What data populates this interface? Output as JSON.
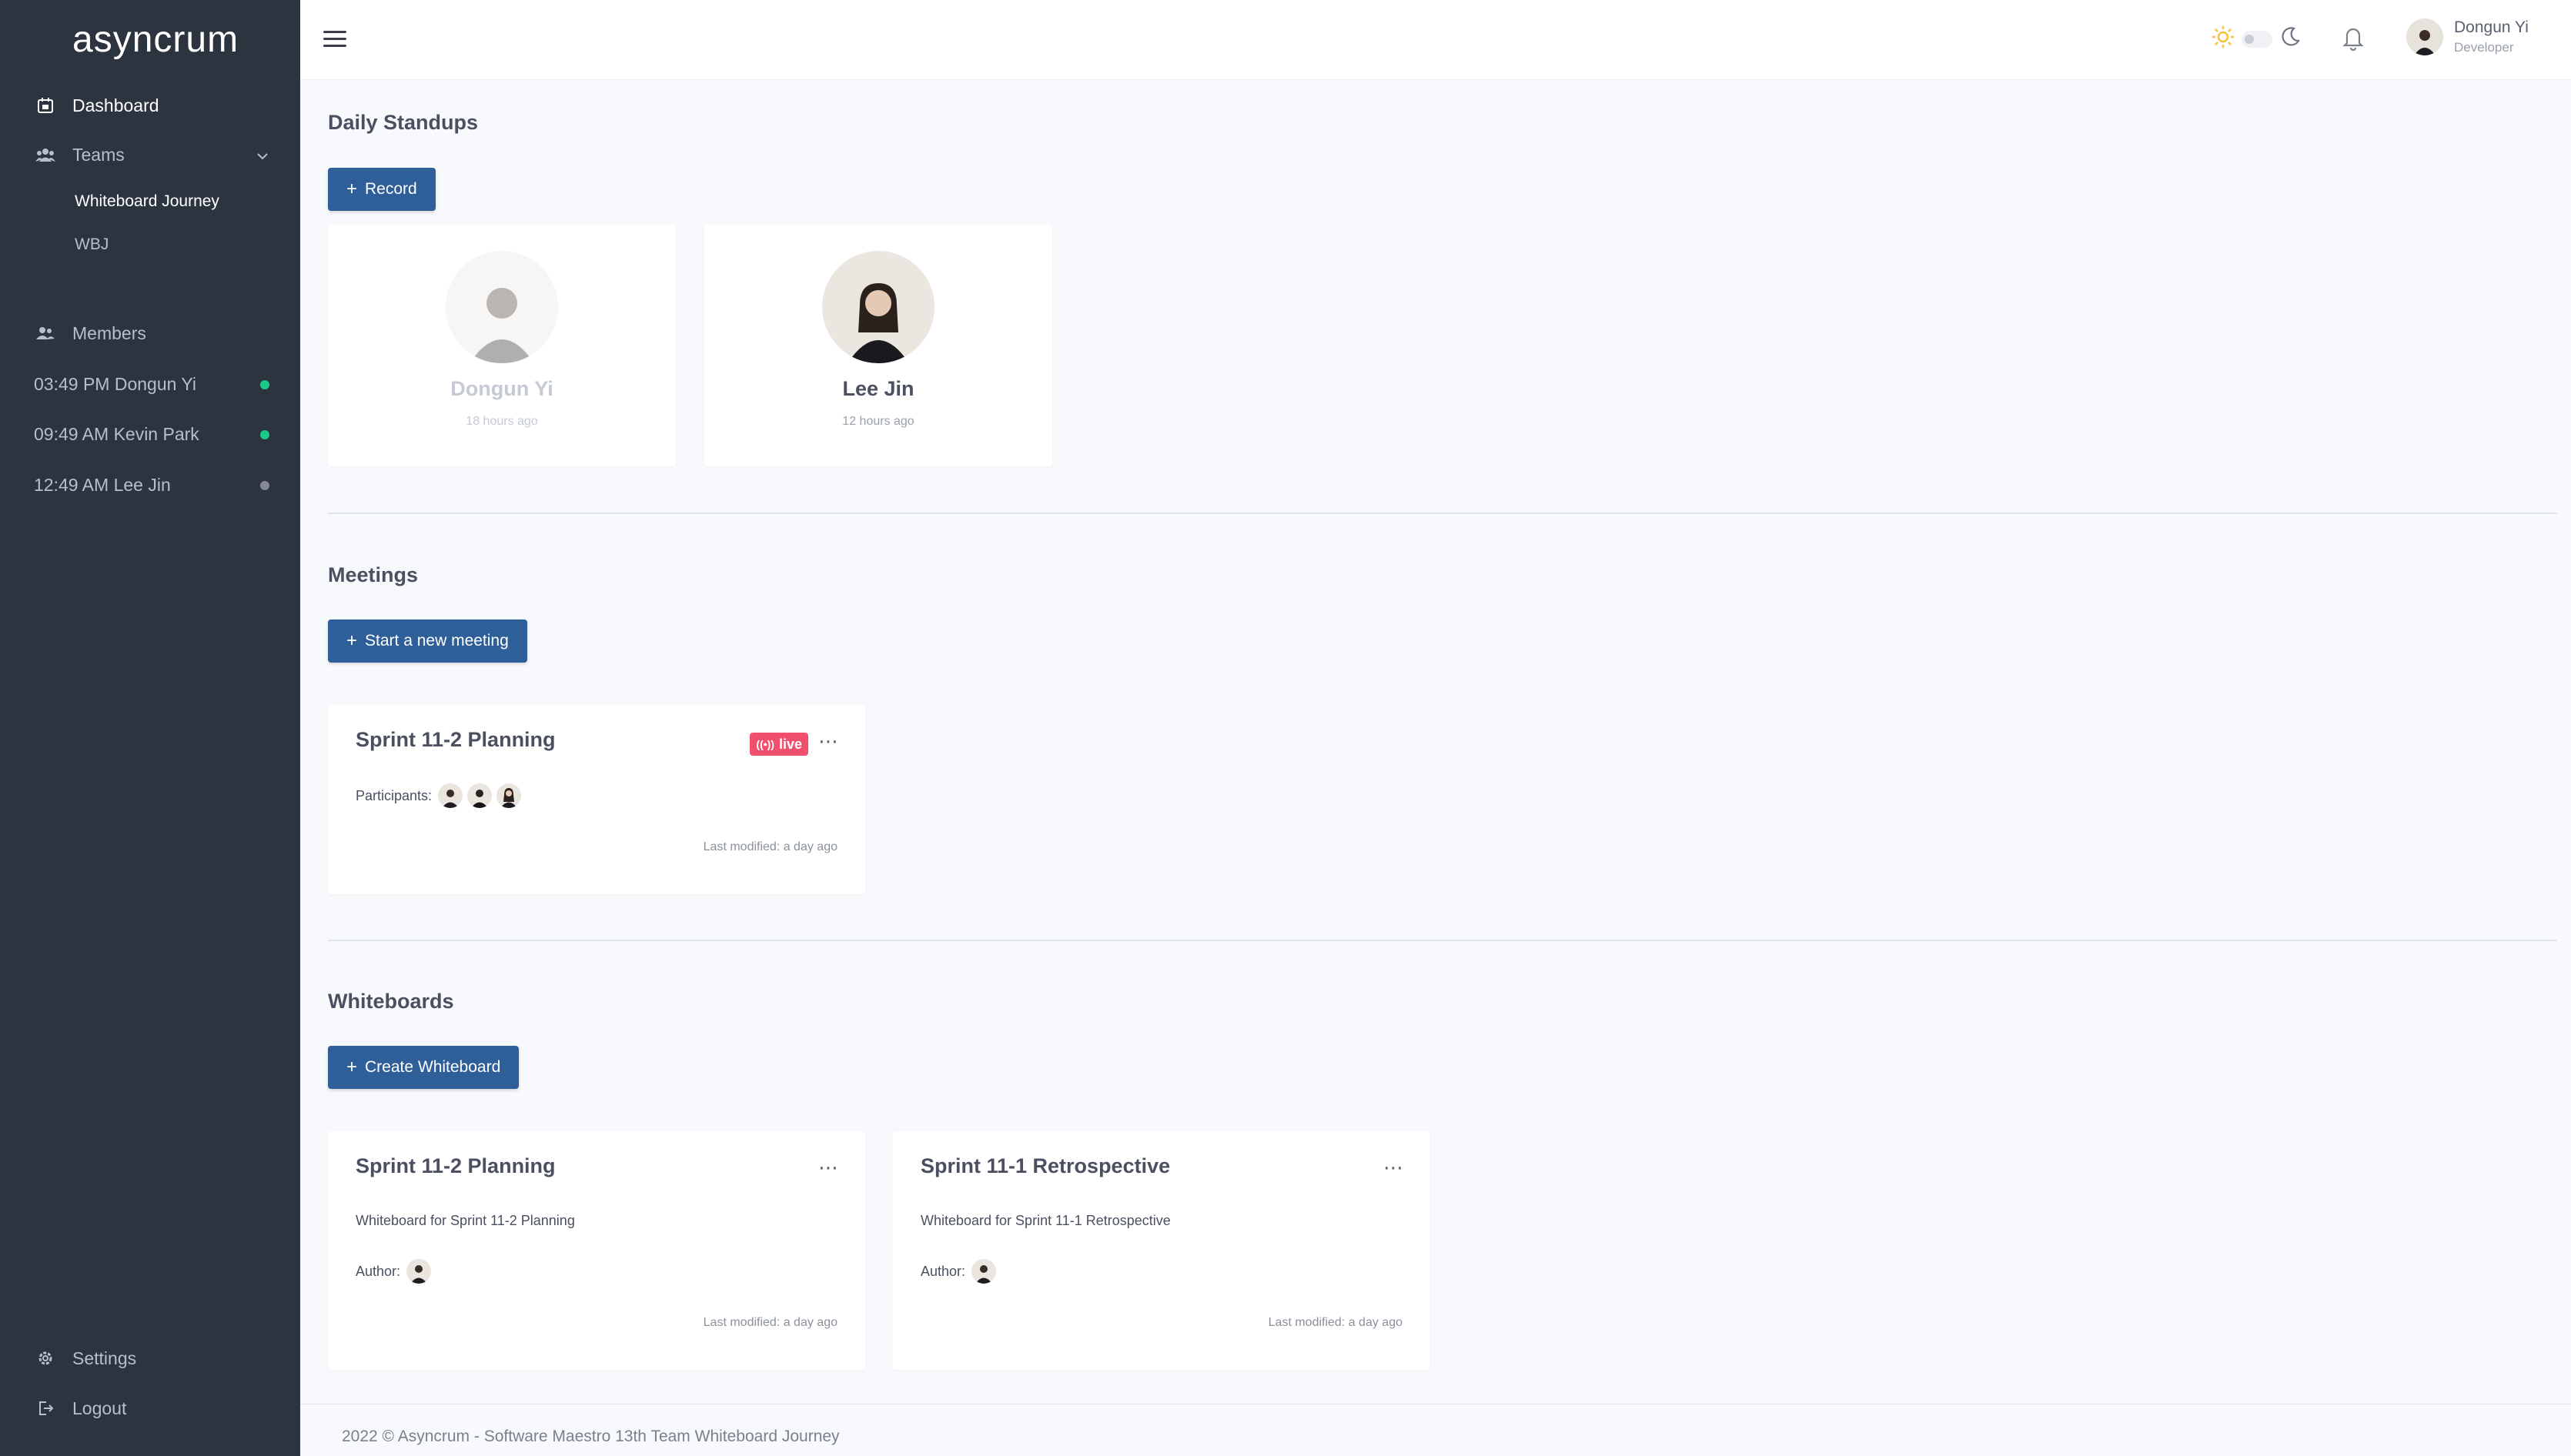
{
  "app": {
    "logo": "asyncrum"
  },
  "sidebar": {
    "dashboard": "Dashboard",
    "teams": "Teams",
    "team_items": [
      "Whiteboard Journey",
      "WBJ"
    ],
    "members_label": "Members",
    "members": [
      {
        "label": "03:49 PM Dongun Yi",
        "status_color": "#1cc88a"
      },
      {
        "label": "09:49 AM Kevin Park",
        "status_color": "#1cc88a"
      },
      {
        "label": "12:49 AM Lee Jin",
        "status_color": "#858796"
      }
    ],
    "settings": "Settings",
    "logout": "Logout"
  },
  "header": {
    "user_name": "Dongun Yi",
    "user_role": "Developer"
  },
  "standups": {
    "title": "Daily Standups",
    "record_button": "Record",
    "cards": [
      {
        "name": "Dongun Yi",
        "time": "18 hours ago"
      },
      {
        "name": "Lee Jin",
        "time": "12 hours ago"
      }
    ]
  },
  "meetings": {
    "title": "Meetings",
    "new_button": "Start a new meeting",
    "cards": [
      {
        "title": "Sprint 11-2 Planning",
        "badge": "live",
        "participants_label": "Participants:",
        "last_modified": "Last modified: a day ago"
      }
    ]
  },
  "whiteboards": {
    "title": "Whiteboards",
    "create_button": "Create Whiteboard",
    "cards": [
      {
        "title": "Sprint 11-2 Planning",
        "description": "Whiteboard for Sprint 11-2 Planning",
        "author_label": "Author:",
        "last_modified": "Last modified: a day ago"
      },
      {
        "title": "Sprint 11-1 Retrospective",
        "description": "Whiteboard for Sprint 11-1 Retrospective",
        "author_label": "Author:",
        "last_modified": "Last modified: a day ago"
      }
    ]
  },
  "footer": {
    "text": "2022 © Asyncrum - Software Maestro 13th Team Whiteboard Journey"
  },
  "colors": {
    "sidebar_bg": "#2c3440",
    "primary": "#2f5f99",
    "live": "#f0506e",
    "online": "#1cc88a",
    "offline": "#858796"
  }
}
